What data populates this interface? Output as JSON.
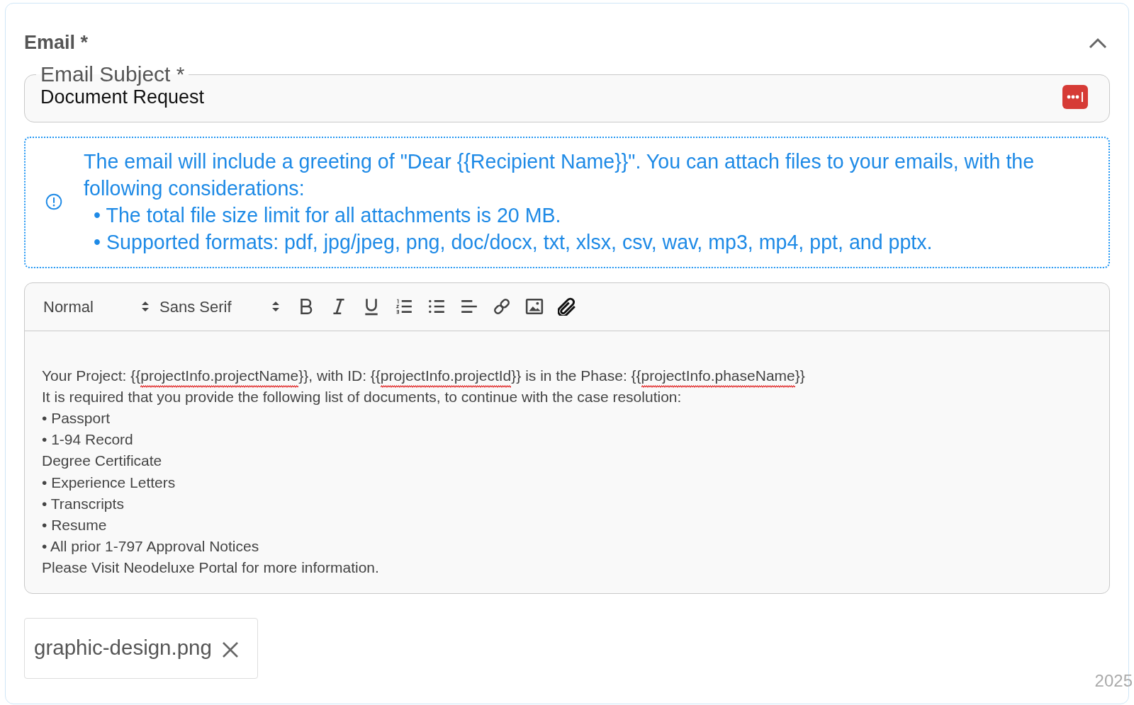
{
  "section": {
    "title": "Email *",
    "expanded": true
  },
  "subject": {
    "label": "Email Subject *",
    "value": "Document Request"
  },
  "info": {
    "lines": [
      "The email will include a greeting of \"Dear {{Recipient Name}}\". You can attach files to your emails, with the following considerations:"
    ],
    "bullets": [
      "• The total file size limit for all attachments is 20 MB.",
      "• Supported formats: pdf, jpg/jpeg, png, doc/docx, txt, xlsx, csv, wav, mp3, mp4, ppt, and pptx."
    ]
  },
  "toolbar": {
    "selects": [
      "Normal",
      "Sans Serif"
    ]
  },
  "body": [
    [
      {
        "text": "Your Project: {{",
        "misspelled": false
      },
      {
        "text": "projectInfo.projectName",
        "misspelled": true
      },
      {
        "text": "}}, with ID: {{",
        "misspelled": false
      },
      {
        "text": "projectInfo.projectId",
        "misspelled": true
      },
      {
        "text": "}} is in the Phase: {{",
        "misspelled": false
      },
      {
        "text": "projectInfo.phaseName",
        "misspelled": true
      },
      {
        "text": "}}",
        "misspelled": false
      }
    ],
    [
      {
        "text": "It is required that you provide the following list of documents, to continue with the case resolution:",
        "misspelled": false
      }
    ],
    [
      {
        "text": "• Passport",
        "misspelled": false
      }
    ],
    [
      {
        "text": "• 1-94 Record",
        "misspelled": false
      }
    ],
    [
      {
        "text": "Degree Certificate",
        "misspelled": false
      }
    ],
    [
      {
        "text": "• Experience Letters",
        "misspelled": false
      }
    ],
    [
      {
        "text": "• Transcripts",
        "misspelled": false
      }
    ],
    [
      {
        "text": "• Resume",
        "misspelled": false
      }
    ],
    [
      {
        "text": "• All prior 1-797 Approval Notices",
        "misspelled": false
      }
    ],
    [
      {
        "text": "Please Visit Neodeluxe Portal for more information.",
        "misspelled": false
      }
    ]
  ],
  "attachments": [
    {
      "name": "graphic-design.png"
    }
  ],
  "footer": "2025"
}
